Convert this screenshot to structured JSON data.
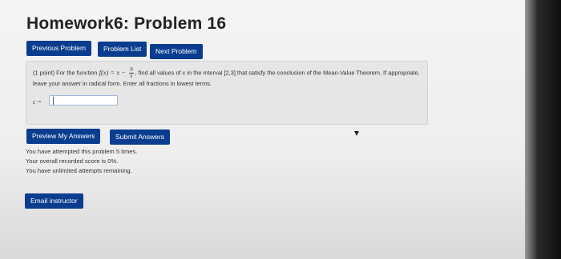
{
  "page": {
    "title": "Homework6: Problem 16"
  },
  "nav": {
    "previous": "Previous Problem",
    "list": "Problem List",
    "next": "Next Problem"
  },
  "problem": {
    "points": "(1 point) For the function",
    "func_lhs": "f(x) = x −",
    "frac_num": "9",
    "frac_den": "x",
    "text_rest": ", find all values of c in the interval [2,3] that satisfy the conclusion of the Mean-Value Theorem. If appropriate, leave your answer in radical form. Enter all fractions in lowest terms.",
    "answer_label": "c =",
    "answer_value": ""
  },
  "actions": {
    "preview": "Preview My Answers",
    "submit": "Submit Answers"
  },
  "status": {
    "attempts": "You have attempted this problem 5 times.",
    "score": "Your overall recorded score is 0%.",
    "remaining": "You have unlimited attempts remaining."
  },
  "email": {
    "label": "Email instructor"
  }
}
